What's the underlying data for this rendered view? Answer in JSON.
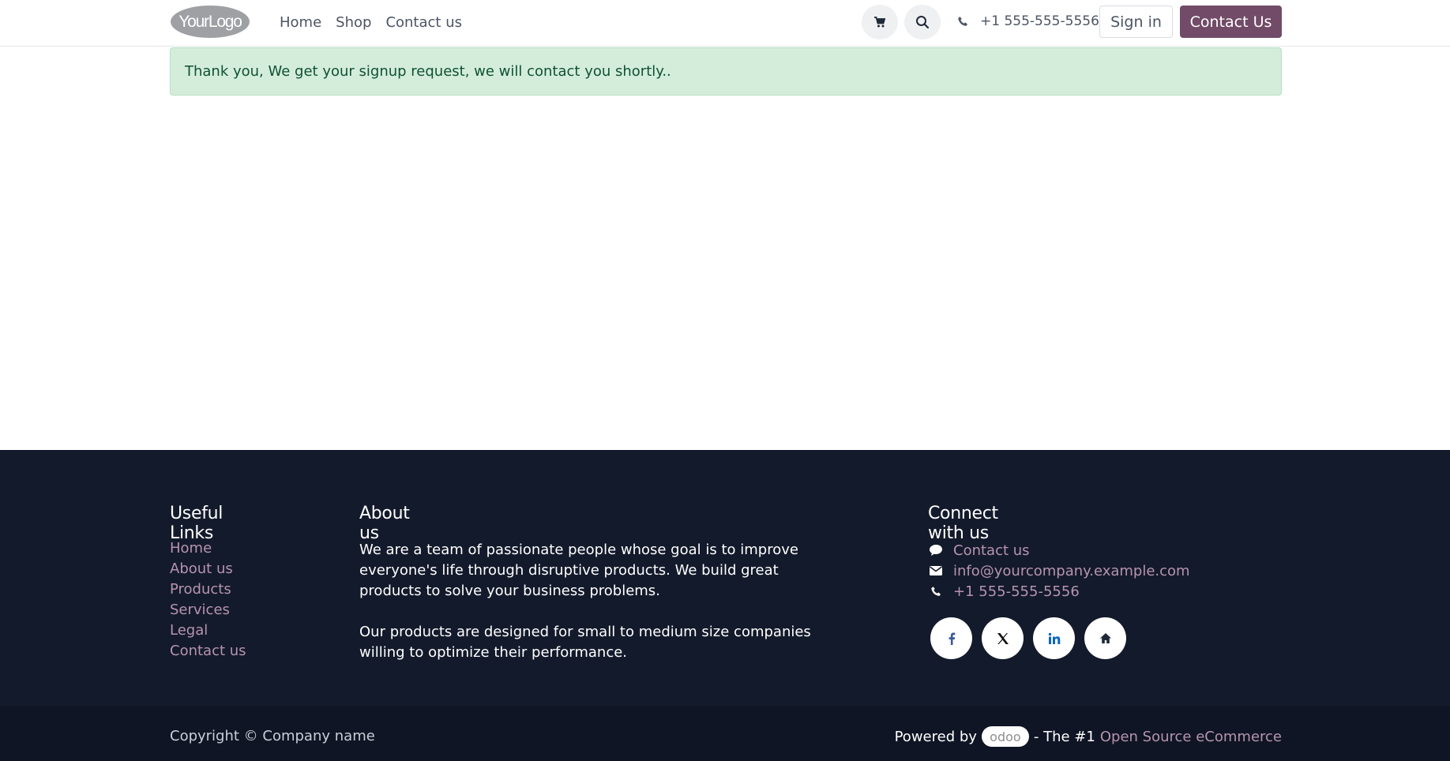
{
  "header": {
    "logo_text": "YourLogo",
    "nav": [
      "Home",
      "Shop",
      "Contact us"
    ],
    "phone": "+1 555-555-5556",
    "signin_label": "Sign in",
    "contact_label": "Contact Us",
    "icons": {
      "cart": "cart-icon",
      "search": "search-icon",
      "phone": "phone-icon"
    }
  },
  "alert": {
    "message": "Thank you, We get your signup request, we will contact you shortly.."
  },
  "footer": {
    "useful_links": {
      "title": "Useful Links",
      "items": [
        "Home",
        "About us",
        "Products",
        "Services",
        "Legal",
        "Contact us"
      ]
    },
    "about": {
      "title": "About us",
      "p1": "We are a team of passionate people whose goal is to improve everyone's life through disruptive products. We build great products to solve your business problems.",
      "p2": "Our products are designed for small to medium size companies willing to optimize their performance."
    },
    "connect": {
      "title": "Connect with us",
      "contact_link": "Contact us",
      "email": "info@yourcompany.example.com",
      "phone": "+1 555-555-5556",
      "social_icons": [
        "facebook-icon",
        "x-twitter-icon",
        "linkedin-icon",
        "home-icon"
      ]
    }
  },
  "bottom": {
    "copyright": "Copyright © Company name",
    "powered_prefix": "Powered by",
    "odoo_badge": "odoo",
    "tagline": "- The #1",
    "tagline_link": "Open Source eCommerce"
  },
  "colors": {
    "brand": "#714b67",
    "footer_bg": "#131a2b",
    "link": "#b694af",
    "alert_bg": "#d4eddb",
    "alert_text": "#0f5132"
  }
}
